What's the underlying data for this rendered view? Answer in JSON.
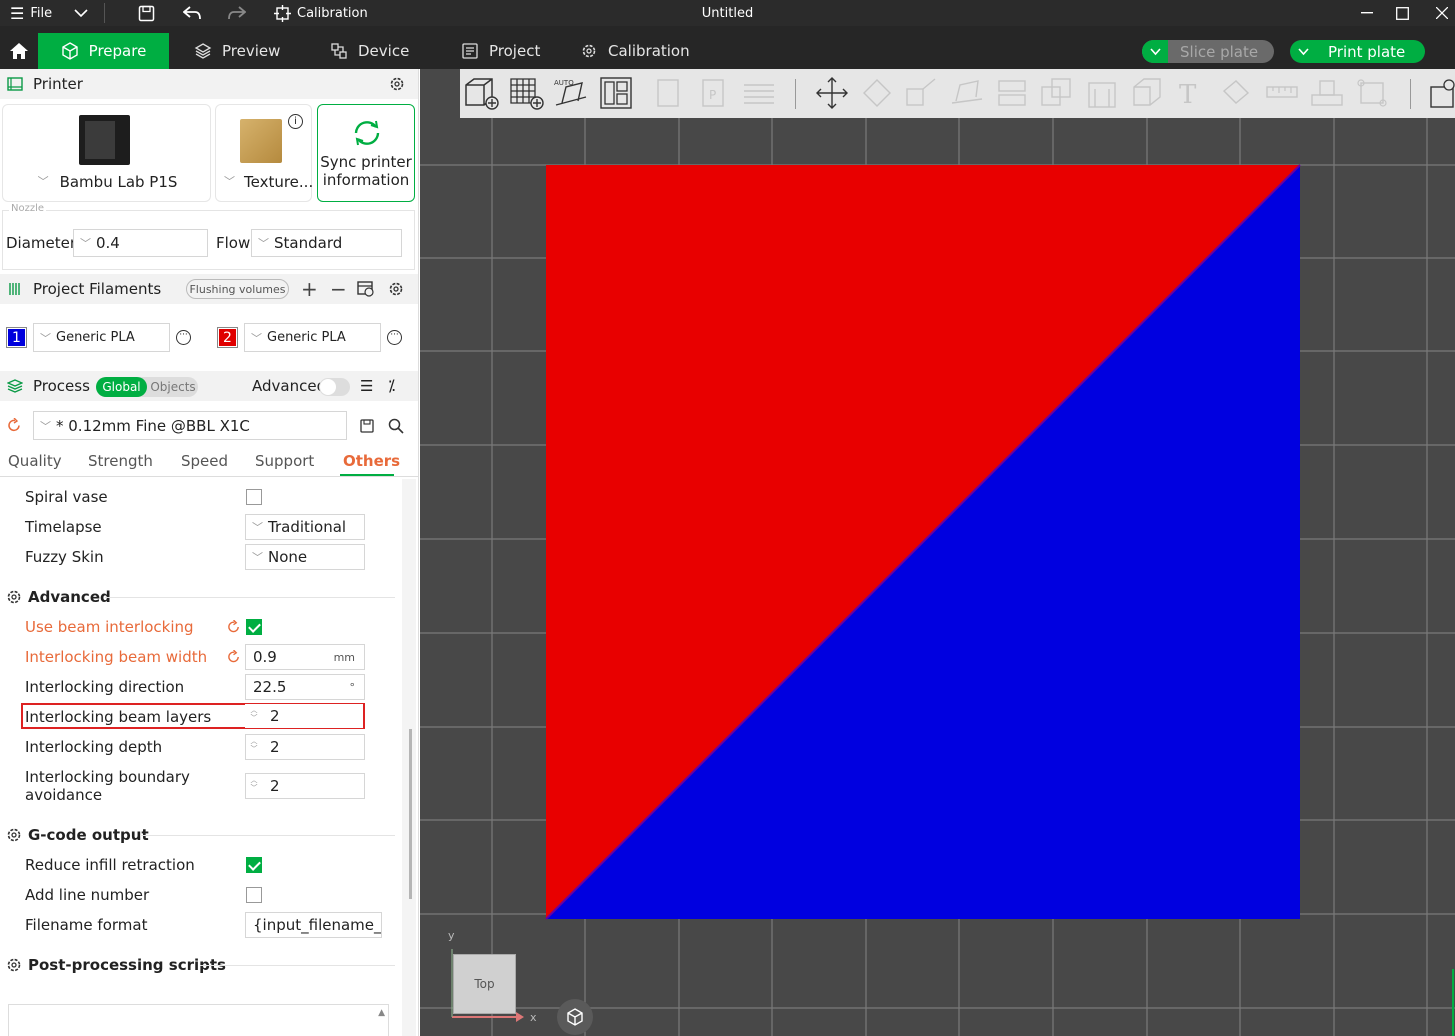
{
  "titlebar": {
    "menu_label": "File",
    "tool_label": "Calibration",
    "window_title": "Untitled"
  },
  "mainbar": {
    "tabs": [
      "Prepare",
      "Preview",
      "Device",
      "Project",
      "Calibration"
    ],
    "slice_label": "Slice plate",
    "print_label": "Print plate"
  },
  "printer": {
    "header": "Printer",
    "printer_name": "Bambu Lab P1S",
    "plate_name": "Texture...",
    "sync_line1": "Sync printer",
    "sync_line2": "information",
    "nozzle_legend": "Nozzle",
    "diameter_label": "Diameter",
    "diameter_value": "0.4",
    "flow_label": "Flow",
    "flow_value": "Standard"
  },
  "filaments": {
    "header": "Project Filaments",
    "flushing_label": "Flushing volumes",
    "items": [
      {
        "index": "1",
        "name": "Generic PLA",
        "color": "#0000dd"
      },
      {
        "index": "2",
        "name": "Generic PLA",
        "color": "#e00000"
      }
    ]
  },
  "process": {
    "header": "Process",
    "toggle_global": "Global",
    "toggle_objects": "Objects",
    "advanced_label": "Advanced",
    "preset": "* 0.12mm Fine @BBL X1C",
    "tabs": [
      "Quality",
      "Strength",
      "Speed",
      "Support",
      "Others"
    ],
    "active_tab": "Others"
  },
  "settings": {
    "spiral_vase": {
      "label": "Spiral vase",
      "checked": false
    },
    "timelapse": {
      "label": "Timelapse",
      "value": "Traditional"
    },
    "fuzzy_skin": {
      "label": "Fuzzy Skin",
      "value": "None"
    },
    "advanced_header": "Advanced",
    "use_beam_interlocking": {
      "label": "Use beam interlocking",
      "checked": true
    },
    "interlocking_beam_width": {
      "label": "Interlocking beam width",
      "value": "0.9",
      "unit": "mm"
    },
    "interlocking_direction": {
      "label": "Interlocking direction",
      "value": "22.5",
      "unit": "°"
    },
    "interlocking_beam_layers": {
      "label": "Interlocking beam layers",
      "value": "2"
    },
    "interlocking_depth": {
      "label": "Interlocking depth",
      "value": "2"
    },
    "interlocking_boundary_line1": "Interlocking boundary",
    "interlocking_boundary_line2": "avoidance",
    "interlocking_boundary_value": "2",
    "gcode_header": "G-code output",
    "reduce_infill_retraction": {
      "label": "Reduce infill retraction",
      "checked": true
    },
    "add_line_number": {
      "label": "Add line number",
      "checked": false
    },
    "filename_format": {
      "label": "Filename format",
      "value": "{input_filename_b"
    },
    "post_processing_header": "Post-processing scripts"
  },
  "viewport": {
    "view_cube_label": "Top",
    "axis_x": "x",
    "axis_y": "y",
    "object_colors": {
      "upper": "#e80000",
      "lower": "#0000e0"
    },
    "bg": "#484848"
  }
}
